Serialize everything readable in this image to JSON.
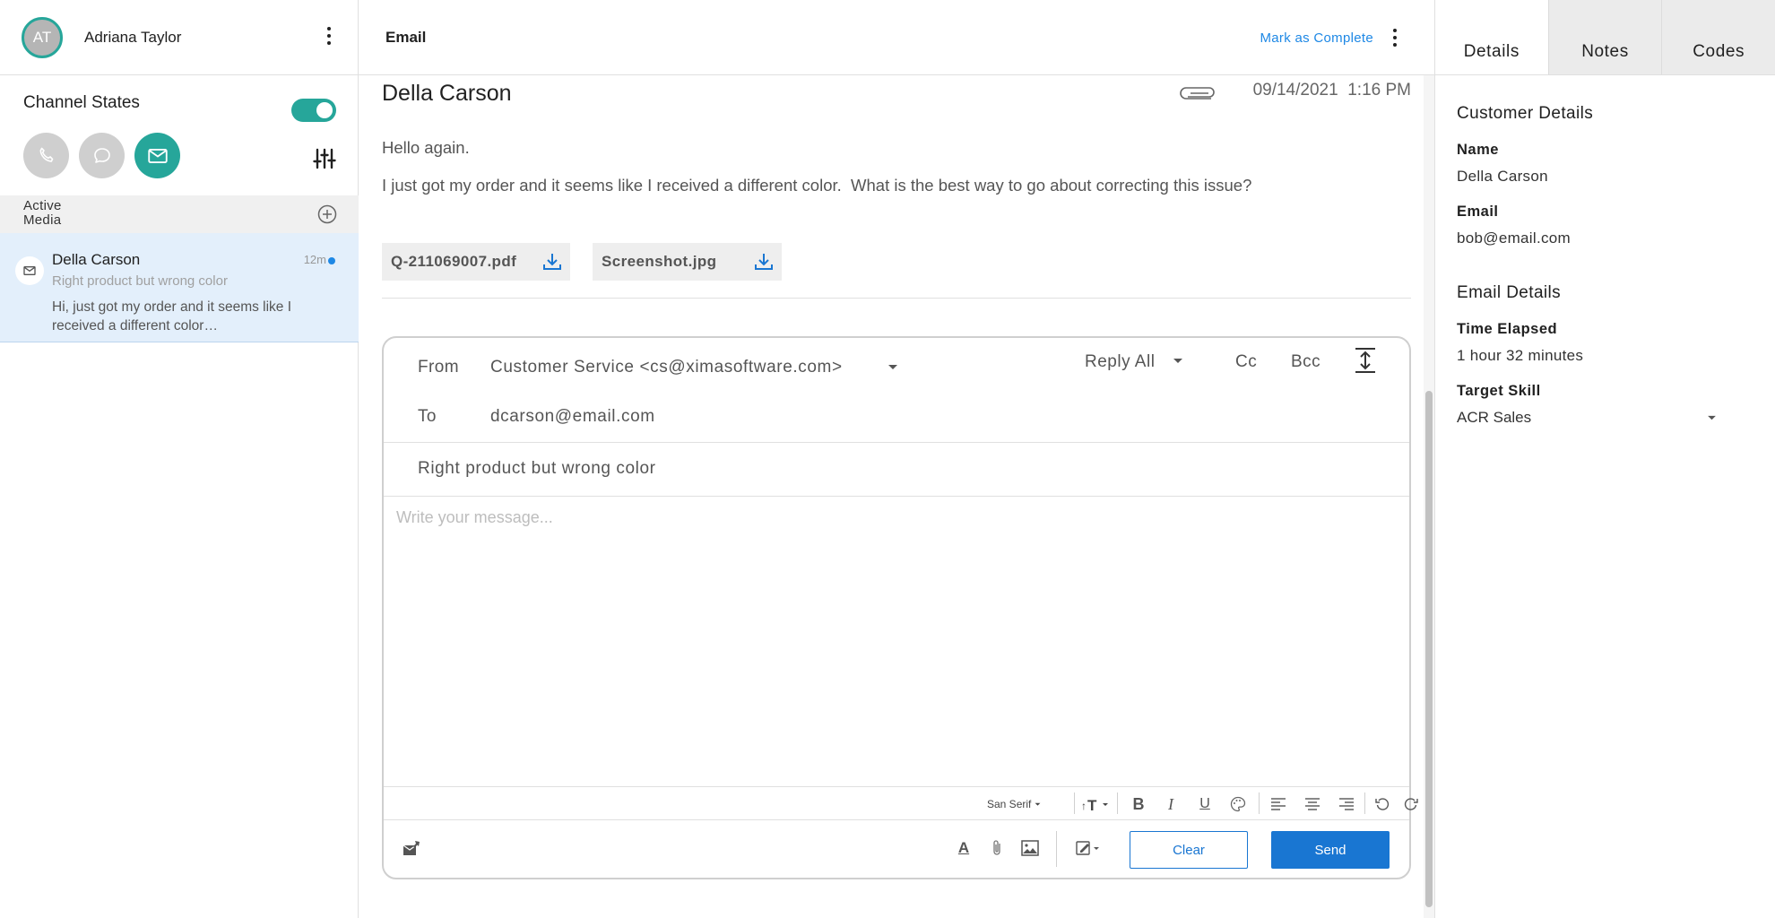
{
  "agent": {
    "initials": "AT",
    "name": "Adriana Taylor"
  },
  "channel_states": {
    "title": "Channel States",
    "toggle_on": true
  },
  "active_media": {
    "label": "Active Media"
  },
  "conversation": {
    "name": "Della Carson",
    "time": "12m",
    "subject": "Right product but wrong color",
    "preview": "Hi, just got my order and it seems like I received a different color…"
  },
  "main_header": {
    "title": "Email",
    "mark_complete": "Mark as Complete"
  },
  "email": {
    "sender": "Della Carson",
    "date": "09/14/2021",
    "time": "1:16 PM",
    "greeting": "Hello again.",
    "body": "I just got my order and it seems like I received a different color.  What is the best way to go about correcting this issue?",
    "attachments": [
      {
        "name": "Q-211069007.pdf"
      },
      {
        "name": "Screenshot.jpg"
      }
    ]
  },
  "compose": {
    "from_label": "From",
    "from_value": "Customer Service <cs@ximasoftware.com>",
    "to_label": "To",
    "to_value": "dcarson@email.com",
    "reply_mode": "Reply All",
    "cc": "Cc",
    "bcc": "Bcc",
    "subject": "Right product but wrong color",
    "placeholder": "Write your message...",
    "font_family": "San Serif",
    "clear": "Clear",
    "send": "Send"
  },
  "right_panel": {
    "tabs": [
      "Details",
      "Notes",
      "Codes"
    ],
    "active_tab": "Details",
    "customer_details_title": "Customer Details",
    "name_label": "Name",
    "name_value": "Della Carson",
    "email_label": "Email",
    "email_value": "bob@email.com",
    "email_details_title": "Email Details",
    "time_elapsed_label": "Time Elapsed",
    "time_elapsed_value": "1 hour 32 minutes",
    "target_skill_label": "Target Skill",
    "target_skill_value": "ACR Sales"
  },
  "colors": {
    "accent": "#26a69a",
    "primary": "#1976d2",
    "unread_dot": "#1e88e5"
  }
}
